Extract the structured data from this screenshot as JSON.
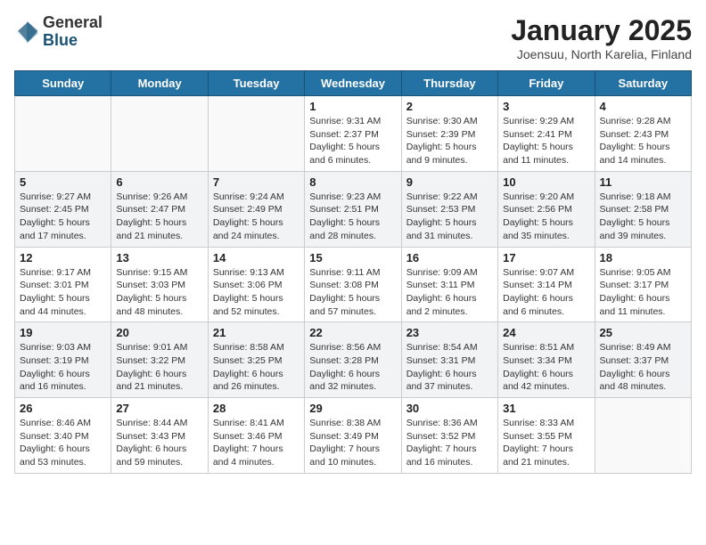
{
  "header": {
    "logo_general": "General",
    "logo_blue": "Blue",
    "month_title": "January 2025",
    "subtitle": "Joensuu, North Karelia, Finland"
  },
  "weekdays": [
    "Sunday",
    "Monday",
    "Tuesday",
    "Wednesday",
    "Thursday",
    "Friday",
    "Saturday"
  ],
  "weeks": [
    [
      {
        "day": "",
        "sunrise": "",
        "sunset": "",
        "daylight": ""
      },
      {
        "day": "",
        "sunrise": "",
        "sunset": "",
        "daylight": ""
      },
      {
        "day": "",
        "sunrise": "",
        "sunset": "",
        "daylight": ""
      },
      {
        "day": "1",
        "sunrise": "Sunrise: 9:31 AM",
        "sunset": "Sunset: 2:37 PM",
        "daylight": "Daylight: 5 hours and 6 minutes."
      },
      {
        "day": "2",
        "sunrise": "Sunrise: 9:30 AM",
        "sunset": "Sunset: 2:39 PM",
        "daylight": "Daylight: 5 hours and 9 minutes."
      },
      {
        "day": "3",
        "sunrise": "Sunrise: 9:29 AM",
        "sunset": "Sunset: 2:41 PM",
        "daylight": "Daylight: 5 hours and 11 minutes."
      },
      {
        "day": "4",
        "sunrise": "Sunrise: 9:28 AM",
        "sunset": "Sunset: 2:43 PM",
        "daylight": "Daylight: 5 hours and 14 minutes."
      }
    ],
    [
      {
        "day": "5",
        "sunrise": "Sunrise: 9:27 AM",
        "sunset": "Sunset: 2:45 PM",
        "daylight": "Daylight: 5 hours and 17 minutes."
      },
      {
        "day": "6",
        "sunrise": "Sunrise: 9:26 AM",
        "sunset": "Sunset: 2:47 PM",
        "daylight": "Daylight: 5 hours and 21 minutes."
      },
      {
        "day": "7",
        "sunrise": "Sunrise: 9:24 AM",
        "sunset": "Sunset: 2:49 PM",
        "daylight": "Daylight: 5 hours and 24 minutes."
      },
      {
        "day": "8",
        "sunrise": "Sunrise: 9:23 AM",
        "sunset": "Sunset: 2:51 PM",
        "daylight": "Daylight: 5 hours and 28 minutes."
      },
      {
        "day": "9",
        "sunrise": "Sunrise: 9:22 AM",
        "sunset": "Sunset: 2:53 PM",
        "daylight": "Daylight: 5 hours and 31 minutes."
      },
      {
        "day": "10",
        "sunrise": "Sunrise: 9:20 AM",
        "sunset": "Sunset: 2:56 PM",
        "daylight": "Daylight: 5 hours and 35 minutes."
      },
      {
        "day": "11",
        "sunrise": "Sunrise: 9:18 AM",
        "sunset": "Sunset: 2:58 PM",
        "daylight": "Daylight: 5 hours and 39 minutes."
      }
    ],
    [
      {
        "day": "12",
        "sunrise": "Sunrise: 9:17 AM",
        "sunset": "Sunset: 3:01 PM",
        "daylight": "Daylight: 5 hours and 44 minutes."
      },
      {
        "day": "13",
        "sunrise": "Sunrise: 9:15 AM",
        "sunset": "Sunset: 3:03 PM",
        "daylight": "Daylight: 5 hours and 48 minutes."
      },
      {
        "day": "14",
        "sunrise": "Sunrise: 9:13 AM",
        "sunset": "Sunset: 3:06 PM",
        "daylight": "Daylight: 5 hours and 52 minutes."
      },
      {
        "day": "15",
        "sunrise": "Sunrise: 9:11 AM",
        "sunset": "Sunset: 3:08 PM",
        "daylight": "Daylight: 5 hours and 57 minutes."
      },
      {
        "day": "16",
        "sunrise": "Sunrise: 9:09 AM",
        "sunset": "Sunset: 3:11 PM",
        "daylight": "Daylight: 6 hours and 2 minutes."
      },
      {
        "day": "17",
        "sunrise": "Sunrise: 9:07 AM",
        "sunset": "Sunset: 3:14 PM",
        "daylight": "Daylight: 6 hours and 6 minutes."
      },
      {
        "day": "18",
        "sunrise": "Sunrise: 9:05 AM",
        "sunset": "Sunset: 3:17 PM",
        "daylight": "Daylight: 6 hours and 11 minutes."
      }
    ],
    [
      {
        "day": "19",
        "sunrise": "Sunrise: 9:03 AM",
        "sunset": "Sunset: 3:19 PM",
        "daylight": "Daylight: 6 hours and 16 minutes."
      },
      {
        "day": "20",
        "sunrise": "Sunrise: 9:01 AM",
        "sunset": "Sunset: 3:22 PM",
        "daylight": "Daylight: 6 hours and 21 minutes."
      },
      {
        "day": "21",
        "sunrise": "Sunrise: 8:58 AM",
        "sunset": "Sunset: 3:25 PM",
        "daylight": "Daylight: 6 hours and 26 minutes."
      },
      {
        "day": "22",
        "sunrise": "Sunrise: 8:56 AM",
        "sunset": "Sunset: 3:28 PM",
        "daylight": "Daylight: 6 hours and 32 minutes."
      },
      {
        "day": "23",
        "sunrise": "Sunrise: 8:54 AM",
        "sunset": "Sunset: 3:31 PM",
        "daylight": "Daylight: 6 hours and 37 minutes."
      },
      {
        "day": "24",
        "sunrise": "Sunrise: 8:51 AM",
        "sunset": "Sunset: 3:34 PM",
        "daylight": "Daylight: 6 hours and 42 minutes."
      },
      {
        "day": "25",
        "sunrise": "Sunrise: 8:49 AM",
        "sunset": "Sunset: 3:37 PM",
        "daylight": "Daylight: 6 hours and 48 minutes."
      }
    ],
    [
      {
        "day": "26",
        "sunrise": "Sunrise: 8:46 AM",
        "sunset": "Sunset: 3:40 PM",
        "daylight": "Daylight: 6 hours and 53 minutes."
      },
      {
        "day": "27",
        "sunrise": "Sunrise: 8:44 AM",
        "sunset": "Sunset: 3:43 PM",
        "daylight": "Daylight: 6 hours and 59 minutes."
      },
      {
        "day": "28",
        "sunrise": "Sunrise: 8:41 AM",
        "sunset": "Sunset: 3:46 PM",
        "daylight": "Daylight: 7 hours and 4 minutes."
      },
      {
        "day": "29",
        "sunrise": "Sunrise: 8:38 AM",
        "sunset": "Sunset: 3:49 PM",
        "daylight": "Daylight: 7 hours and 10 minutes."
      },
      {
        "day": "30",
        "sunrise": "Sunrise: 8:36 AM",
        "sunset": "Sunset: 3:52 PM",
        "daylight": "Daylight: 7 hours and 16 minutes."
      },
      {
        "day": "31",
        "sunrise": "Sunrise: 8:33 AM",
        "sunset": "Sunset: 3:55 PM",
        "daylight": "Daylight: 7 hours and 21 minutes."
      },
      {
        "day": "",
        "sunrise": "",
        "sunset": "",
        "daylight": ""
      }
    ]
  ]
}
